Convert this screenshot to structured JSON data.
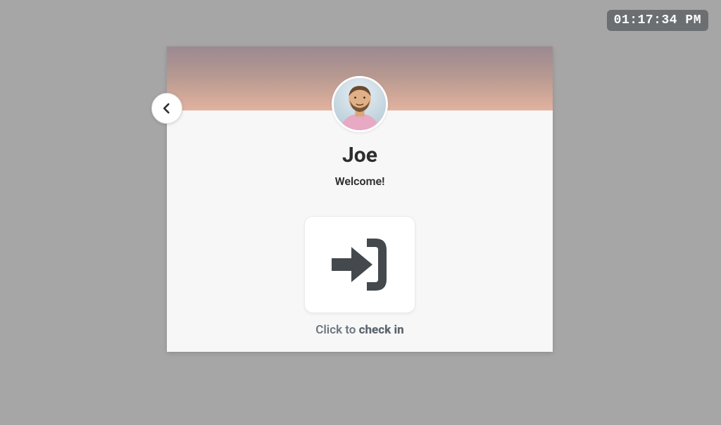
{
  "clock": {
    "time": "01:17:34 PM"
  },
  "user": {
    "name": "Joe",
    "welcome": "Welcome!"
  },
  "checkin": {
    "prefix": "Click to ",
    "action": "check in"
  }
}
